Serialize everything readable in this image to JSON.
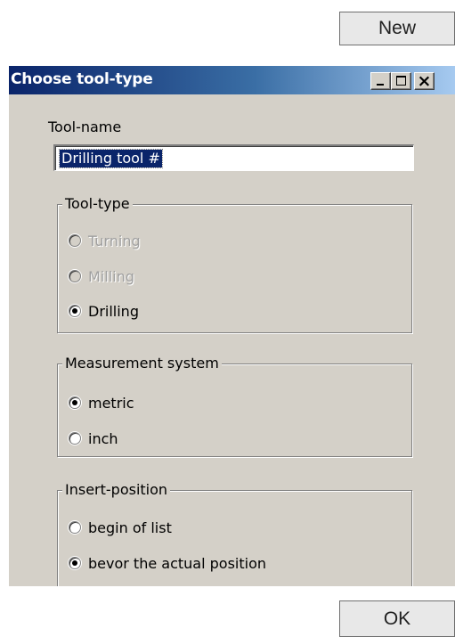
{
  "top_button": {
    "label": "New"
  },
  "bottom_button": {
    "label": "OK"
  },
  "dialog": {
    "title": "Choose tool-type",
    "caption_buttons": {
      "minimize": "_",
      "maximize": "□",
      "close": "×"
    },
    "tool_name": {
      "label": "Tool-name",
      "value": "Drilling tool #"
    },
    "tool_type": {
      "title": "Tool-type",
      "options": [
        {
          "label": "Turning",
          "selected": false,
          "enabled": false
        },
        {
          "label": "Milling",
          "selected": false,
          "enabled": false
        },
        {
          "label": "Drilling",
          "selected": true,
          "enabled": true
        }
      ]
    },
    "measurement": {
      "title": "Measurement system",
      "options": [
        {
          "label": "metric",
          "selected": true
        },
        {
          "label": "inch",
          "selected": false
        }
      ]
    },
    "insert_position": {
      "title": "Insert-position",
      "options": [
        {
          "label": "begin of list",
          "selected": false
        },
        {
          "label": "bevor the actual position",
          "selected": true
        }
      ]
    }
  }
}
